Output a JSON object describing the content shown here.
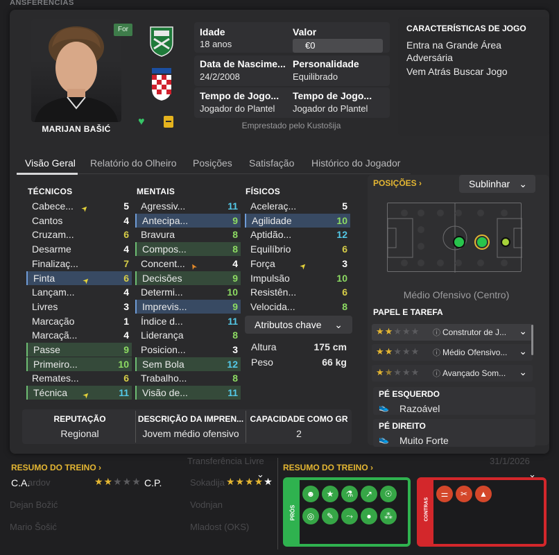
{
  "background_title": "ANSFERENCIAS",
  "player": {
    "name": "MARIJAN BAŠIĆ",
    "for_badge": "For",
    "age_label": "Idade",
    "age_value": "18 anos",
    "value_label": "Valor",
    "value_value": "€0",
    "dob_label": "Data de Nascime...",
    "dob_value": "24/2/2008",
    "personality_label": "Personalidade",
    "personality_value": "Equilibrado",
    "playing_time_label_1": "Tempo de Jogo...",
    "playing_time_value_1": "Jogador do Plantel",
    "playing_time_label_2": "Tempo de Jogo...",
    "playing_time_value_2": "Jogador do Plantel",
    "loan_note": "Emprestado pelo Kustošija"
  },
  "characteristics": {
    "title": "CARACTERÍSTICAS DE JOGO",
    "items": [
      "Entra na Grande Área Adversária",
      "Vem Atrás Buscar Jogo"
    ]
  },
  "tabs": [
    "Visão Geral",
    "Relatório do Olheiro",
    "Posições",
    "Satisfação",
    "Histórico do Jogador"
  ],
  "attributes": {
    "technical_title": "TÉCNICOS",
    "mental_title": "MENTAIS",
    "physical_title": "FÍSICOS",
    "technical": [
      {
        "label": "Cabece...",
        "value": "5",
        "arrow": "up-yellow"
      },
      {
        "label": "Cantos",
        "value": "4"
      },
      {
        "label": "Cruzam...",
        "value": "6"
      },
      {
        "label": "Desarme",
        "value": "4"
      },
      {
        "label": "Finalizaç...",
        "value": "7"
      },
      {
        "label": "Finta",
        "value": "6",
        "arrow": "up-yellow"
      },
      {
        "label": "Lançam...",
        "value": "4"
      },
      {
        "label": "Livres",
        "value": "3"
      },
      {
        "label": "Marcação",
        "value": "1"
      },
      {
        "label": "Marcaçã...",
        "value": "4"
      },
      {
        "label": "Passe",
        "value": "9"
      },
      {
        "label": "Primeiro...",
        "value": "10"
      },
      {
        "label": "Remates...",
        "value": "6"
      },
      {
        "label": "Técnica",
        "value": "11",
        "arrow": "up-yellow"
      }
    ],
    "mental": [
      {
        "label": "Agressiv...",
        "value": "11"
      },
      {
        "label": "Antecipa...",
        "value": "9"
      },
      {
        "label": "Bravura",
        "value": "8"
      },
      {
        "label": "Compos...",
        "value": "8"
      },
      {
        "label": "Concent...",
        "value": "4",
        "arrow": "up-orange"
      },
      {
        "label": "Decisões",
        "value": "9"
      },
      {
        "label": "Determi...",
        "value": "10"
      },
      {
        "label": "Imprevis...",
        "value": "9"
      },
      {
        "label": "Índice d...",
        "value": "11"
      },
      {
        "label": "Liderança",
        "value": "8"
      },
      {
        "label": "Posicion...",
        "value": "3"
      },
      {
        "label": "Sem Bola",
        "value": "12"
      },
      {
        "label": "Trabalho...",
        "value": "8"
      },
      {
        "label": "Visão de...",
        "value": "11"
      }
    ],
    "physical": [
      {
        "label": "Aceleraç...",
        "value": "5"
      },
      {
        "label": "Agilidade",
        "value": "10"
      },
      {
        "label": "Aptidão...",
        "value": "12"
      },
      {
        "label": "Equilíbrio",
        "value": "6"
      },
      {
        "label": "Força",
        "value": "3",
        "arrow": "up-yellow"
      },
      {
        "label": "Impulsão",
        "value": "10"
      },
      {
        "label": "Resistên...",
        "value": "6"
      },
      {
        "label": "Velocida...",
        "value": "8"
      }
    ],
    "key_attributes_button": "Atributos chave",
    "height_label": "Altura",
    "height_value": "175 cm",
    "weight_label": "Peso",
    "weight_value": "66 kg"
  },
  "summary_strip": {
    "reputation_label": "REPUTAÇÃO",
    "reputation_value": "Regional",
    "press_label": "DESCRIÇÃO DA IMPREN...",
    "press_value": "Jovem médio ofensivo",
    "gk_label": "CAPACIDADE COMO GR",
    "gk_value": "2"
  },
  "positions": {
    "title": "POSIÇÕES",
    "dropdown": "Sublinhar",
    "position_name": "Médio Ofensivo (Centro)",
    "role_title": "PAPEL E TAREFA",
    "roles": [
      {
        "name": "Construtor de J...",
        "stars": 2.0
      },
      {
        "name": "Médio Ofensivo...",
        "stars": 2.0
      },
      {
        "name": "Avançado Som...",
        "stars": 1.5
      }
    ],
    "left_foot_label": "PÉ ESQUERDO",
    "left_foot_value": "Razoável",
    "right_foot_label": "PÉ DIREITO",
    "right_foot_value": "Muito Forte"
  },
  "training_left": {
    "title": "RESUMO DO TREINO",
    "ca_label": "C.A.",
    "ca_stars": 2,
    "cp_label": "C.P.",
    "cp_stars": 4.5
  },
  "training_right": {
    "title": "RESUMO DO TREINO",
    "pros_label": "PRÓS",
    "contras_label": "CONTRAS"
  },
  "background_rows": {
    "names": [
      "ardov",
      "Dejan Božić",
      "Mario Šošić"
    ],
    "clubs": [
      "Sokadija",
      "Vodnjan",
      "Mladost (OKS)"
    ],
    "transfer": "Transferência Livre",
    "dates": [
      "31/1/2026"
    ]
  },
  "colors": {
    "accent_gold": "#e4b632",
    "pros_green": "#2fb24f",
    "contras_red": "#d3272b",
    "highlight_blue": "#384a63",
    "highlight_green": "#354a3a"
  }
}
